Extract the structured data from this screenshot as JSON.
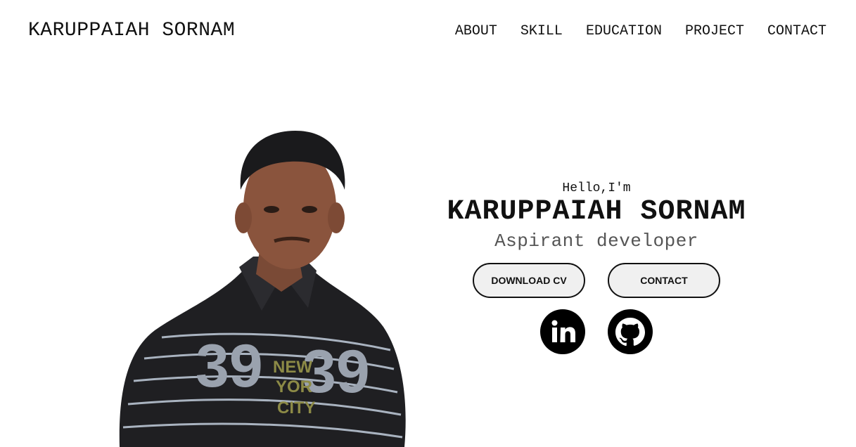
{
  "header": {
    "logo": "KARUPPAIAH SORNAM",
    "nav": [
      "ABOUT",
      "SKILL",
      "EDUCATION",
      "PROJECT",
      "CONTACT"
    ]
  },
  "hero": {
    "greeting": "Hello,I'm",
    "name": "KARUPPAIAH SORNAM",
    "role": "Aspirant developer",
    "buttons": {
      "download": "DOWNLOAD CV",
      "contact": "CONTACT"
    },
    "social": {
      "linkedin_icon": "linkedin-icon",
      "github_icon": "github-icon"
    }
  },
  "colors": {
    "text": "#111111",
    "role_text": "#555555",
    "button_bg": "#f0f0f0",
    "shirt": "#1f1f22",
    "background": "#ffffff"
  }
}
